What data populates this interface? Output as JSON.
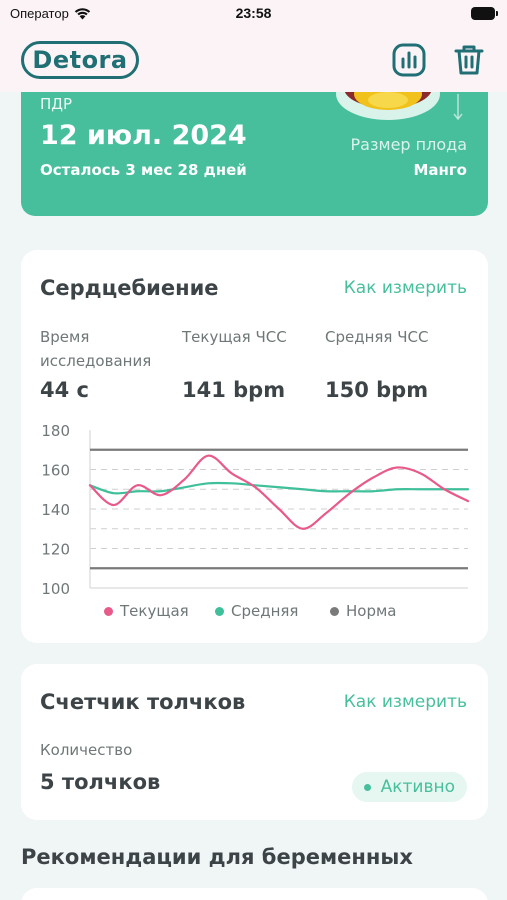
{
  "status": {
    "carrier": "Оператор",
    "time": "23:58"
  },
  "header": {
    "logo": "Detora",
    "icons": [
      "stats-icon",
      "trash-icon"
    ]
  },
  "due": {
    "label": "ПДР",
    "date": "12 июл. 2024",
    "remaining": "Осталось 3 мес 28 дней",
    "size_label": "Размер плода",
    "size_value": "Манго"
  },
  "heart": {
    "title": "Сердцебиение",
    "link": "Как измерить",
    "stats": [
      {
        "label": "Время исследования",
        "value": "44 с"
      },
      {
        "label": "Текущая ЧСС",
        "value": "141 bpm"
      },
      {
        "label": "Средняя ЧСС",
        "value": "150 bpm"
      }
    ],
    "legend": [
      "Текущая",
      "Средняя",
      "Норма"
    ]
  },
  "kicks": {
    "title": "Счетчик толчков",
    "link": "Как измерить",
    "count_label": "Количество",
    "count_value": "5 толчков",
    "status": "Активно"
  },
  "recommendations": {
    "title": "Рекомендации для беременных"
  },
  "colors": {
    "accent": "#47bf9c",
    "current": "#e85a8a",
    "average": "#3fbf9a",
    "norm": "#7a7a7a",
    "logo": "#1f6f75"
  },
  "chart_data": {
    "type": "line",
    "ylim": [
      100,
      180
    ],
    "yticks": [
      100,
      120,
      140,
      160,
      180
    ],
    "x": [
      0,
      1,
      2,
      3,
      4,
      5,
      6,
      7,
      8,
      9,
      10,
      11,
      12,
      13,
      14,
      15,
      16,
      17,
      18,
      19
    ],
    "series": [
      {
        "name": "Текущая",
        "values": [
          152,
          142,
          152,
          147,
          155,
          167,
          158,
          151,
          140,
          130,
          138,
          148,
          156,
          161,
          158,
          150,
          144,
          0,
          0,
          0
        ]
      },
      {
        "name": "Средняя",
        "values": [
          152,
          148,
          149,
          149,
          151,
          153,
          153,
          152,
          151,
          150,
          149,
          149,
          149,
          150,
          150,
          150,
          150,
          0,
          0,
          0
        ]
      }
    ],
    "norm": [
      110,
      170
    ]
  }
}
